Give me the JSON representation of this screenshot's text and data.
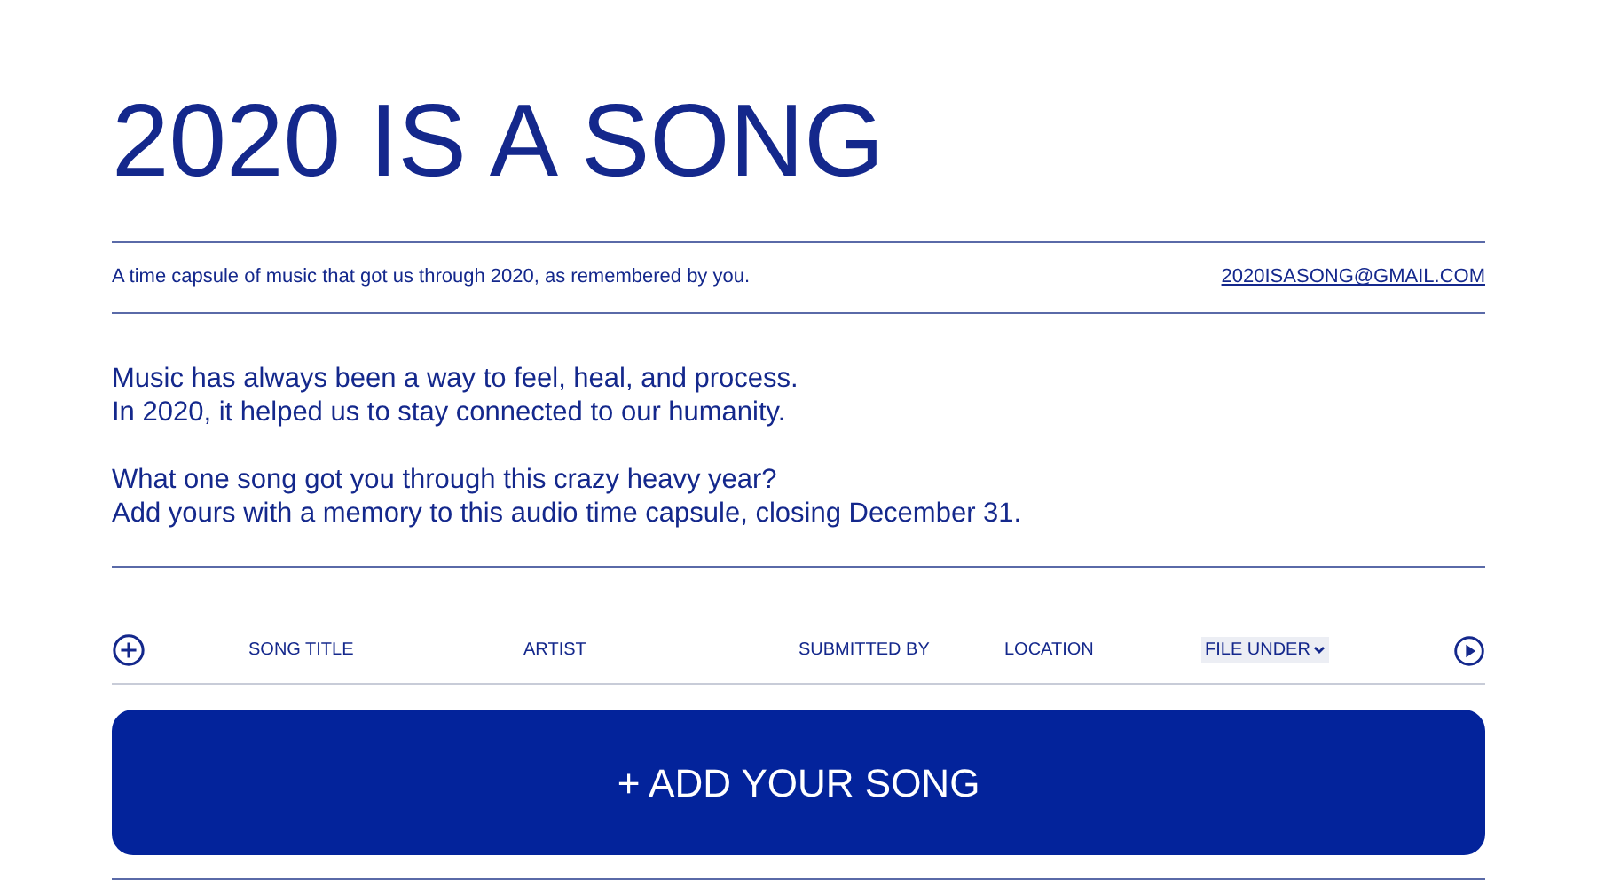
{
  "title": "2020 IS A SONG",
  "tagline": "A time capsule of music that got us through 2020, as remembered by you.",
  "email": "2020ISASONG@GMAIL.COM",
  "intro": [
    {
      "lines": [
        "Music has always been a way to feel, heal, and process.",
        "In 2020, it helped us to stay connected to our humanity."
      ]
    },
    {
      "lines": [
        "What one song got you through this crazy heavy year?",
        "Add yours with a memory to this audio time capsule, closing December 31."
      ]
    }
  ],
  "table": {
    "columns": [
      {
        "label": "SONG TITLE",
        "kind": "plain"
      },
      {
        "label": "ARTIST",
        "kind": "plain"
      },
      {
        "label": "SUBMITTED BY",
        "kind": "plain"
      },
      {
        "label": "LOCATION",
        "kind": "plain"
      },
      {
        "label": "FILE UNDER",
        "kind": "dropdown"
      }
    ]
  },
  "add_button": "+ ADD YOUR SONG"
}
